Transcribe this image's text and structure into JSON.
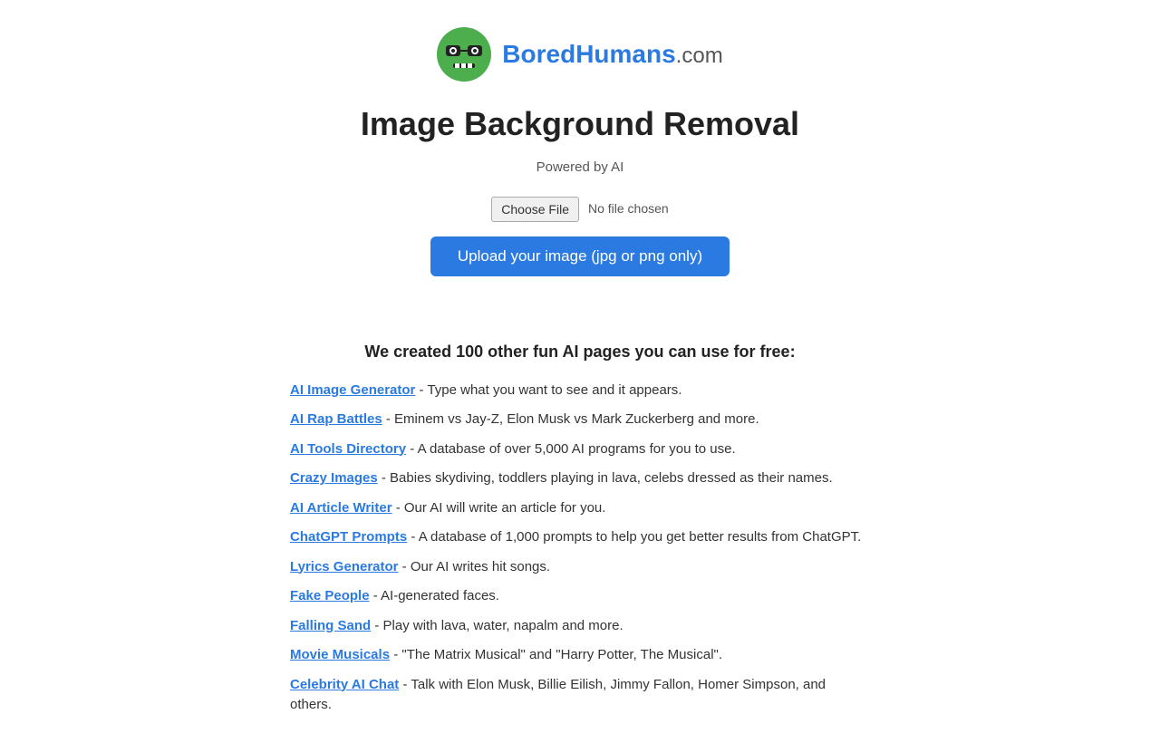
{
  "logo": {
    "text_bored": "Bored",
    "text_humans": "Humans",
    "text_dot_com": ".com"
  },
  "page": {
    "title": "Image Background Removal",
    "powered_by": "Powered by AI"
  },
  "file_input": {
    "choose_file_label": "Choose File",
    "no_file_label": "No file chosen"
  },
  "upload_button": {
    "label": "Upload your image (jpg or png only)"
  },
  "promo": {
    "heading": "We created 100 other fun AI pages you can use for free:",
    "items": [
      {
        "link_text": "AI Image Generator",
        "description": " - Type what you want to see and it appears."
      },
      {
        "link_text": "AI Rap Battles",
        "description": " - Eminem vs Jay-Z, Elon Musk vs Mark Zuckerberg and more."
      },
      {
        "link_text": "AI Tools Directory",
        "description": " - A database of over 5,000 AI programs for you to use."
      },
      {
        "link_text": "Crazy Images",
        "description": " - Babies skydiving, toddlers playing in lava, celebs dressed as their names."
      },
      {
        "link_text": "AI Article Writer",
        "description": " - Our AI will write an article for you."
      },
      {
        "link_text": "ChatGPT Prompts",
        "description": " - A database of 1,000 prompts to help you get better results from ChatGPT."
      },
      {
        "link_text": "Lyrics Generator",
        "description": " - Our AI writes hit songs."
      },
      {
        "link_text": "Fake People",
        "description": " - AI-generated faces."
      },
      {
        "link_text": "Falling Sand",
        "description": " - Play with lava, water, napalm and more."
      },
      {
        "link_text": "Movie Musicals",
        "description": " - \"The Matrix Musical\" and \"Harry Potter, The Musical\"."
      },
      {
        "link_text": "Celebrity AI Chat",
        "description": " - Talk with Elon Musk, Billie Eilish, Jimmy Fallon, Homer Simpson, and others."
      }
    ]
  },
  "colors": {
    "accent": "#2a7ae2",
    "text_dark": "#222",
    "text_mid": "#555"
  }
}
